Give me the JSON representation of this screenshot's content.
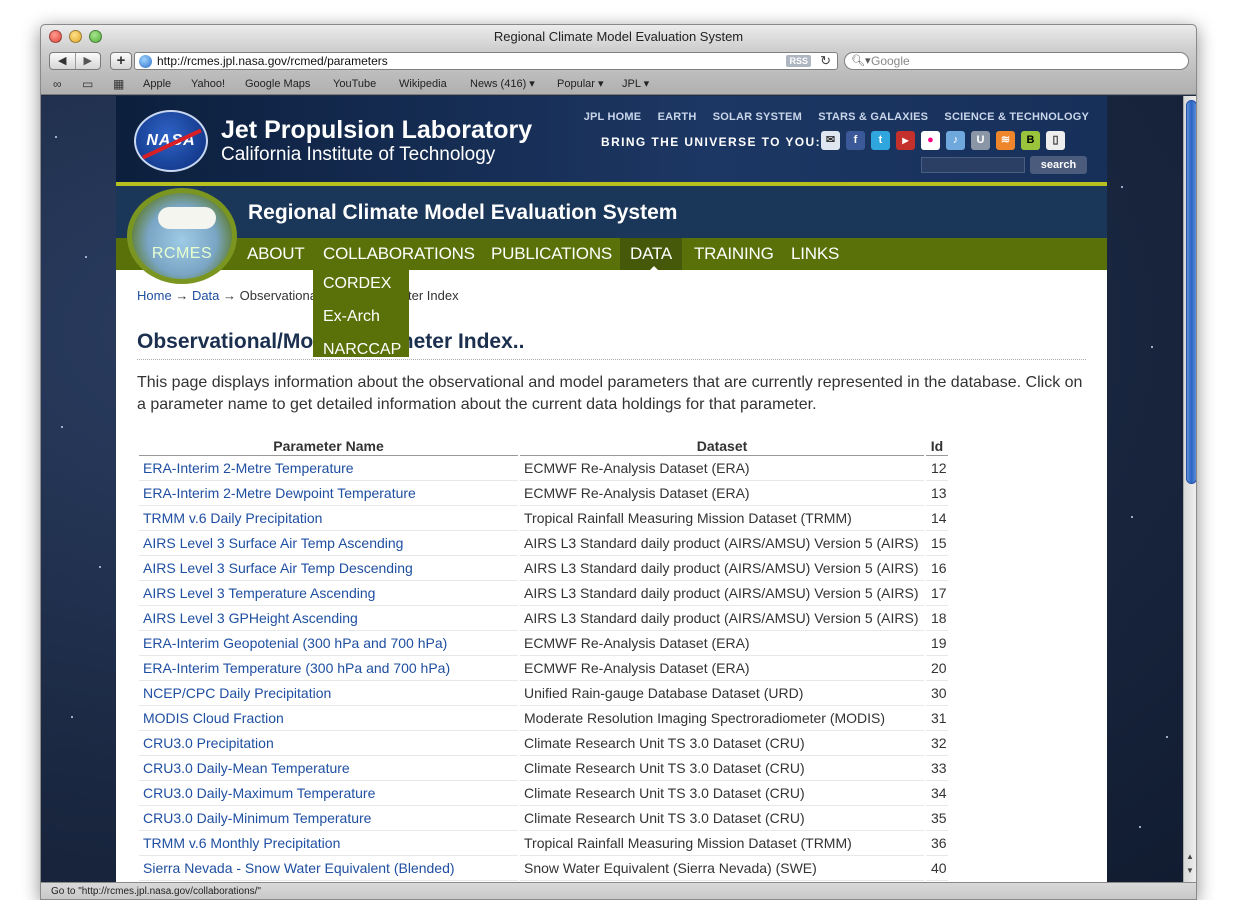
{
  "window": {
    "title": "Regional Climate Model Evaluation System"
  },
  "browser": {
    "url": "http://rcmes.jpl.nasa.gov/rcmed/parameters",
    "rss_label": "RSS",
    "search_placeholder": "Google",
    "bookmarks": [
      "Apple",
      "Yahoo!",
      "Google Maps",
      "YouTube",
      "Wikipedia",
      "News (416) ▾",
      "Popular ▾",
      "JPL ▾"
    ],
    "status": "Go to \"http://rcmes.jpl.nasa.gov/collaborations/\""
  },
  "header": {
    "logo_text": "NASA",
    "title": "Jet Propulsion Laboratory",
    "subtitle": "California Institute of Technology",
    "topnav": [
      "JPL HOME",
      "EARTH",
      "SOLAR SYSTEM",
      "STARS & GALAXIES",
      "SCIENCE & TECHNOLOGY"
    ],
    "bring": "BRING THE UNIVERSE TO YOU:",
    "search_button": "search"
  },
  "site": {
    "title": "Regional Climate Model Evaluation System",
    "logo_label": "RCMES",
    "menu": [
      "ABOUT",
      "COLLABORATIONS",
      "PUBLICATIONS",
      "DATA",
      "TRAINING",
      "LINKS"
    ],
    "dropdown": [
      "CORDEX",
      "Ex-Arch",
      "NARCCAP"
    ]
  },
  "breadcrumb": {
    "home": "Home",
    "sep1": "→",
    "data": "Data",
    "sep2": "→",
    "current": "Observational/Model Parameter Index"
  },
  "main": {
    "title": "Observational/Model Parameter Index..",
    "intro": "This page displays information about the observational and model parameters that are currently represented in the database. Click on a parameter name to get detailed information about the current data holdings for that parameter.",
    "table": {
      "headers": [
        "Parameter Name",
        "Dataset",
        "Id"
      ],
      "rows": [
        [
          "ERA-Interim 2-Metre Temperature",
          "ECMWF Re-Analysis Dataset (ERA)",
          "12"
        ],
        [
          "ERA-Interim 2-Metre Dewpoint Temperature",
          "ECMWF Re-Analysis Dataset (ERA)",
          "13"
        ],
        [
          "TRMM v.6 Daily Precipitation",
          "Tropical Rainfall Measuring Mission Dataset (TRMM)",
          "14"
        ],
        [
          "AIRS Level 3 Surface Air Temp Ascending",
          "AIRS L3 Standard daily product (AIRS/AMSU) Version 5 (AIRS)",
          "15"
        ],
        [
          "AIRS Level 3 Surface Air Temp Descending",
          "AIRS L3 Standard daily product (AIRS/AMSU) Version 5 (AIRS)",
          "16"
        ],
        [
          "AIRS Level 3 Temperature Ascending",
          "AIRS L3 Standard daily product (AIRS/AMSU) Version 5 (AIRS)",
          "17"
        ],
        [
          "AIRS Level 3 GPHeight Ascending",
          "AIRS L3 Standard daily product (AIRS/AMSU) Version 5 (AIRS)",
          "18"
        ],
        [
          "ERA-Interim Geopotenial (300 hPa and 700 hPa)",
          "ECMWF Re-Analysis Dataset (ERA)",
          "19"
        ],
        [
          "ERA-Interim Temperature (300 hPa and 700 hPa)",
          "ECMWF Re-Analysis Dataset (ERA)",
          "20"
        ],
        [
          "NCEP/CPC Daily Precipitation",
          "Unified Rain-gauge Database Dataset (URD)",
          "30"
        ],
        [
          "MODIS Cloud Fraction",
          "Moderate Resolution Imaging Spectroradiometer (MODIS)",
          "31"
        ],
        [
          "CRU3.0 Precipitation",
          "Climate Research Unit TS 3.0 Dataset (CRU)",
          "32"
        ],
        [
          "CRU3.0 Daily-Mean Temperature",
          "Climate Research Unit TS 3.0 Dataset (CRU)",
          "33"
        ],
        [
          "CRU3.0 Daily-Maximum Temperature",
          "Climate Research Unit TS 3.0 Dataset (CRU)",
          "34"
        ],
        [
          "CRU3.0 Daily-Minimum Temperature",
          "Climate Research Unit TS 3.0 Dataset (CRU)",
          "35"
        ],
        [
          "TRMM v.6 Monthly Precipitation",
          "Tropical Rainfall Measuring Mission Dataset (TRMM)",
          "36"
        ],
        [
          "Sierra Nevada - Snow Water Equivalent (Blended)",
          "Snow Water Equivalent (Sierra Nevada) (SWE)",
          "40"
        ]
      ]
    }
  },
  "colors": {
    "menu_green": "#5a7008",
    "link_blue": "#1f4fa1",
    "accent_yellow": "#b8c01f",
    "header_navy": "#1a3658"
  }
}
